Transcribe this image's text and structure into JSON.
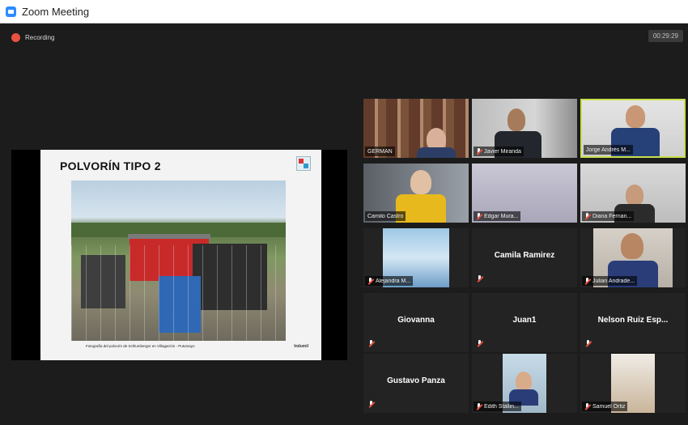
{
  "window": {
    "title": "Zoom Meeting"
  },
  "status": {
    "recording_label": "Recording",
    "timer": "00:29:29"
  },
  "shared_slide": {
    "title": "POLVORÍN TIPO 2",
    "caption": "Fotografía del polvorín de Schlumberger en Villagarzón - Putumayo",
    "brand": "Indumil"
  },
  "participants": [
    {
      "name": "GERMAN",
      "muted": false,
      "video": true
    },
    {
      "name": "Javier Miranda",
      "muted": true,
      "video": true
    },
    {
      "name": "Jorge Andrés M...",
      "muted": false,
      "video": true,
      "active_speaker": true
    },
    {
      "name": "Camilo Castro",
      "muted": false,
      "video": true
    },
    {
      "name": "Edgar Mura...",
      "muted": true,
      "video": true
    },
    {
      "name": "Diana Fernan...",
      "muted": true,
      "video": true
    },
    {
      "name": "Alejandra M...",
      "muted": true,
      "video": true
    },
    {
      "name": "Camila Ramirez",
      "muted": true,
      "video": false
    },
    {
      "name": "Julian Andrade...",
      "muted": true,
      "video": true
    },
    {
      "name": "Giovanna",
      "muted": true,
      "video": false
    },
    {
      "name": "Juan1",
      "muted": true,
      "video": false
    },
    {
      "name": "Nelson Ruiz Esp...",
      "muted": true,
      "video": false
    },
    {
      "name": "Gustavo Panza",
      "muted": true,
      "video": false
    },
    {
      "name": "Edith Stallin...",
      "muted": true,
      "video": true
    },
    {
      "name": "Samuel Ortiz",
      "muted": true,
      "video": true
    }
  ],
  "colors": {
    "active_speaker_border": "#c8e04c",
    "muted_mic": "#e8523f",
    "recording_dot": "#e8523f",
    "background": "#1c1c1c"
  }
}
